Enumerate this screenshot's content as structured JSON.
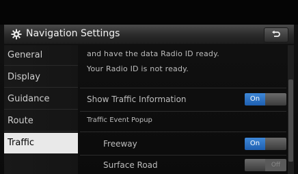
{
  "header": {
    "title": "Navigation Settings",
    "icon": "gear-icon",
    "back_icon": "back-arrow-icon"
  },
  "sidebar": {
    "items": [
      {
        "label": "General"
      },
      {
        "label": "Display"
      },
      {
        "label": "Guidance"
      },
      {
        "label": "Route"
      },
      {
        "label": "Traffic",
        "active": true
      }
    ]
  },
  "content": {
    "info_line1": "and have the data Radio ID ready.",
    "info_line2": "Your Radio ID is not ready.",
    "show_traffic_label": "Show Traffic Information",
    "show_traffic_toggle": "On",
    "popup_label": "Traffic Event Popup",
    "freeway_label": "Freeway",
    "freeway_toggle": "On",
    "surface_label": "Surface Road",
    "surface_toggle": "Off"
  },
  "colors": {
    "toggle_on": "#2b72c6",
    "active_tab_bg": "#e9e9e9"
  }
}
